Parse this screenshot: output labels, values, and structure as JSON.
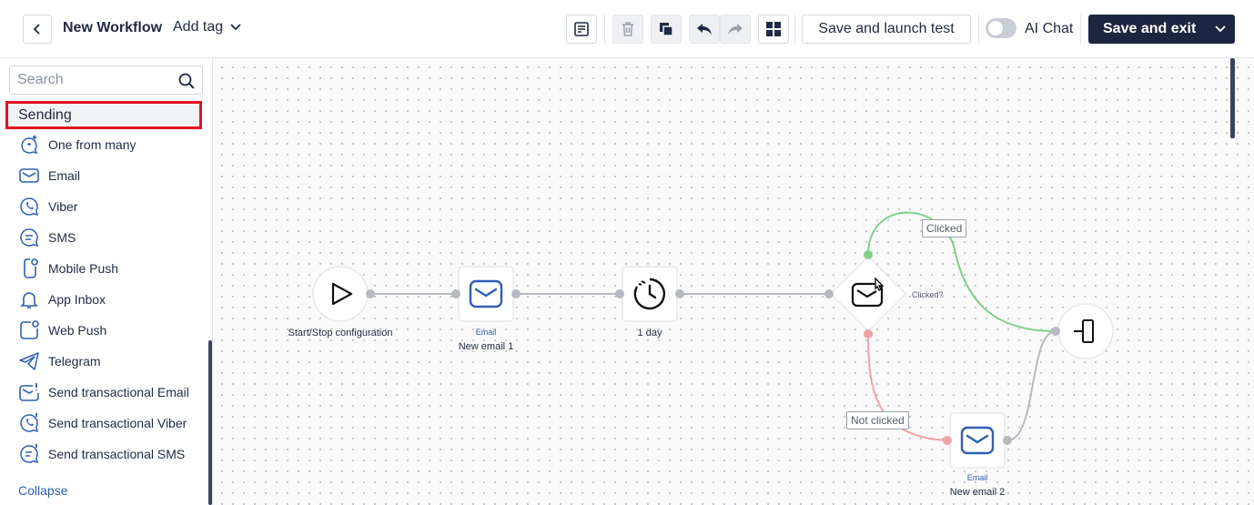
{
  "header": {
    "title": "New Workflow",
    "add_tag": "Add tag",
    "save_test_label": "Save and launch test",
    "ai_chat_label": "AI Chat",
    "save_exit_label": "Save and exit"
  },
  "sidebar": {
    "search_placeholder": "Search",
    "section_title": "Sending",
    "items": [
      {
        "label": "One from many",
        "icon": "sparkle-chat-icon"
      },
      {
        "label": "Email",
        "icon": "envelope-icon"
      },
      {
        "label": "Viber",
        "icon": "viber-icon"
      },
      {
        "label": "SMS",
        "icon": "sms-icon"
      },
      {
        "label": "Mobile Push",
        "icon": "mobile-push-icon"
      },
      {
        "label": "App Inbox",
        "icon": "bell-icon"
      },
      {
        "label": "Web Push",
        "icon": "web-push-icon"
      },
      {
        "label": "Telegram",
        "icon": "telegram-icon"
      },
      {
        "label": "Send transactional Email",
        "icon": "transactional-email-icon"
      },
      {
        "label": "Send transactional Viber",
        "icon": "transactional-viber-icon"
      },
      {
        "label": "Send transactional SMS",
        "icon": "transactional-sms-icon"
      }
    ],
    "collapse_label": "Collapse"
  },
  "flow": {
    "start": {
      "label": "Start/Stop configuration"
    },
    "email1": {
      "type": "Email",
      "label": "New email 1"
    },
    "delay": {
      "label": "1 day"
    },
    "condition": {
      "label": "Clicked?"
    },
    "branch_yes": "Clicked",
    "branch_no": "Not clicked",
    "email2": {
      "type": "Email",
      "label": "New email 2"
    }
  },
  "colors": {
    "accent": "#1d2640",
    "link": "#2f5fb3",
    "highlight": "#e0141e",
    "branch_yes": "#7fd08a",
    "branch_no": "#f0a3a3",
    "edge": "#b5b9c0"
  }
}
